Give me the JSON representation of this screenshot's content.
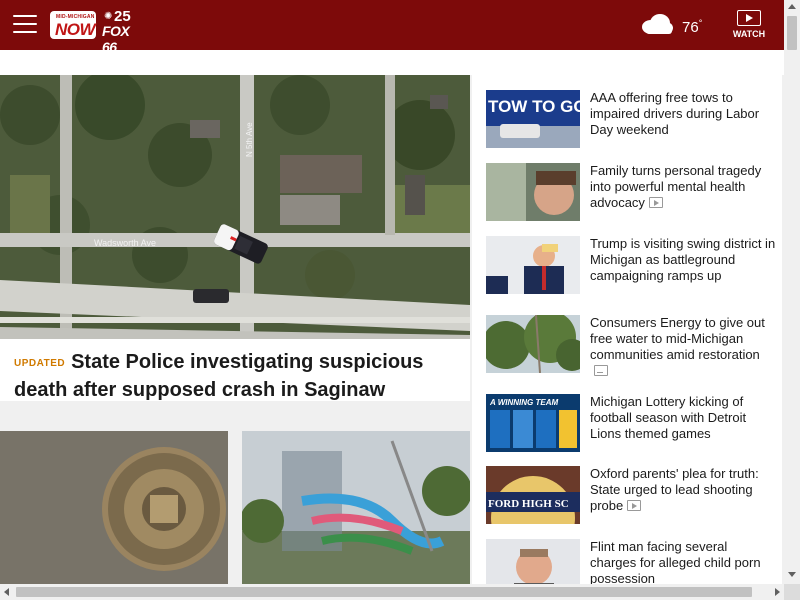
{
  "header": {
    "logo_small": "MID-MICHIGAN",
    "logo_now": "NOW",
    "logo_nbc": "25",
    "logo_fox": "FOX 66",
    "weather_icon": "cloud-icon",
    "temperature": "76",
    "degree": "°",
    "watch_label": "WATCH",
    "bg_color": "#7d0a0a"
  },
  "hero": {
    "badge": "UPDATED",
    "title": "State Police investigating suspicious death after supposed crash in Saginaw",
    "map_label_street1": "Wadsworth Ave",
    "map_label_street2": "N 5th Ave"
  },
  "sidebar": {
    "stories": [
      {
        "headline": "AAA offering free tows to impaired drivers during Labor Day weekend",
        "media": "",
        "thumb_text": "TOW TO GO"
      },
      {
        "headline": "Family turns personal tragedy into powerful mental health advocacy",
        "media": "video",
        "thumb_text": ""
      },
      {
        "headline": "Trump is visiting swing district in Michigan as battleground campaigning ramps up",
        "media": "",
        "thumb_text": ""
      },
      {
        "headline": "Consumers Energy to give out free water to mid-Michigan communities amid restoration",
        "media": "gallery",
        "thumb_text": ""
      },
      {
        "headline": "Michigan Lottery kicking of football season with Detroit Lions themed games",
        "media": "",
        "thumb_text": "A WINNING TEAM"
      },
      {
        "headline": "Oxford parents' plea for truth: State urged to lead shooting probe",
        "media": "video",
        "thumb_text": "FORD HIGH SC"
      },
      {
        "headline": "Flint man facing several charges for alleged child porn possession",
        "media": "",
        "thumb_text": ""
      }
    ]
  }
}
